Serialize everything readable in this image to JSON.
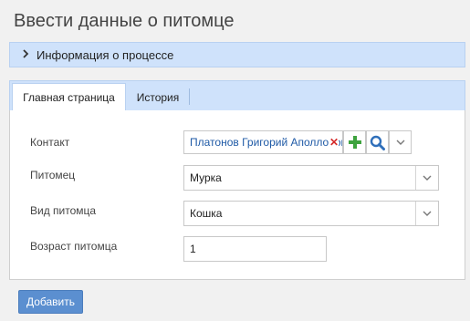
{
  "page": {
    "title": "Ввести данные о питомце"
  },
  "process_panel": {
    "label": "Информация о процессе"
  },
  "tabs": [
    {
      "label": "Главная страница"
    },
    {
      "label": "История"
    }
  ],
  "form": {
    "contact": {
      "label": "Контакт",
      "value": "Платонов Григорий Аполлонович"
    },
    "pet": {
      "label": "Питомец",
      "value": "Мурка"
    },
    "pet_type": {
      "label": "Вид питомца",
      "value": "Кошка"
    },
    "pet_age": {
      "label": "Возраст питомца",
      "value": "1"
    }
  },
  "actions": {
    "add_label": "Добавить"
  },
  "colors": {
    "accent": "#5b8fd0",
    "panel": "#cfe2fb",
    "add_icon": "#3ea33e",
    "clear_icon": "#d52b2b"
  },
  "icons": [
    "chevron-right-icon",
    "clear-icon",
    "plus-icon",
    "search-icon",
    "chevron-down-icon"
  ]
}
